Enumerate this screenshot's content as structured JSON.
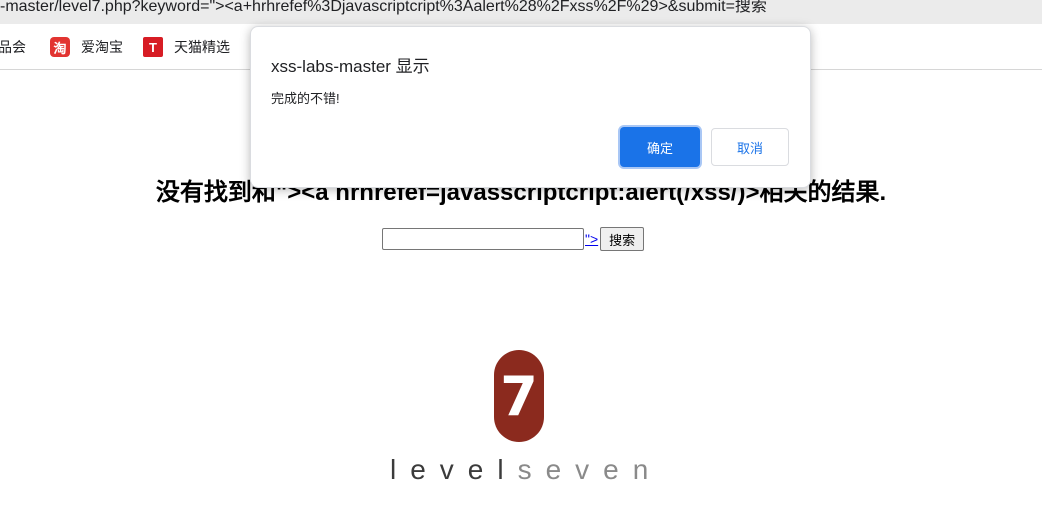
{
  "browser": {
    "url": "-master/level7.php?keyword=\"><a+hrhrefef%3Djavascriptcript%3Aalert%28%2Fxss%2F%29>&submit=搜索",
    "bookmarks": [
      {
        "label": "品会",
        "icon": "none"
      },
      {
        "label": "爱淘宝",
        "icon": "taobao-icon",
        "glyph": "淘",
        "color": "#e23431"
      },
      {
        "label": "天猫精选",
        "icon": "tmall-icon",
        "glyph": "T",
        "color": "#d71c24"
      }
    ]
  },
  "page": {
    "heading": "没有找到和\"><a hrhrefef=javasscriptcript:alert(/xss/)>相关的结果.",
    "search": {
      "input_value": "",
      "link_text": "\">",
      "submit_label": "搜索"
    },
    "logo": {
      "badge_text": "7",
      "text_dark": "level",
      "text_light": "seven",
      "badge_color": "#8b2a1e"
    }
  },
  "dialog": {
    "title": "xss-labs-master 显示",
    "message": "完成的不错!",
    "ok_label": "确定",
    "cancel_label": "取消",
    "accent_color": "#1a73e8"
  }
}
